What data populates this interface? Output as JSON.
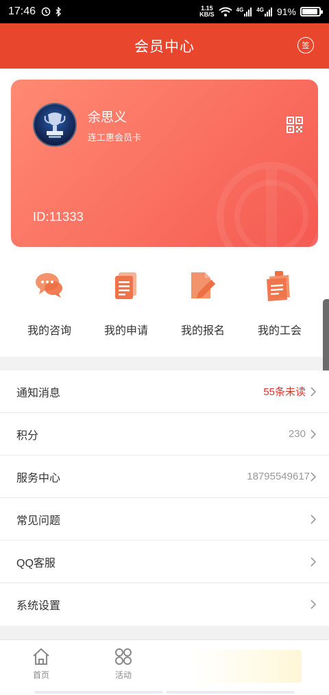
{
  "status_bar": {
    "time": "17:46",
    "network_speed_value": "1.15",
    "network_speed_unit": "KB/S",
    "signal_1_label": "4G",
    "signal_2_label": "4G",
    "battery_percent": "91%",
    "battery_level": 0.91
  },
  "header": {
    "title": "会员中心",
    "sign_label": "签"
  },
  "card": {
    "name": "余思义",
    "card_type": "连工惠会员卡",
    "id_text": "ID:11333",
    "colors": {
      "start": "#ff8a72",
      "end": "#f55a52"
    }
  },
  "shortcuts": [
    {
      "label": "我的咨询",
      "icon": "chat-bubbles-icon"
    },
    {
      "label": "我的申请",
      "icon": "document-list-icon"
    },
    {
      "label": "我的报名",
      "icon": "edit-document-icon"
    },
    {
      "label": "我的工会",
      "icon": "clipboard-note-icon"
    }
  ],
  "menu": [
    {
      "label": "通知消息",
      "value": "55条未读",
      "value_color": "#d9362b"
    },
    {
      "label": "积分",
      "value": "230"
    },
    {
      "label": "服务中心",
      "value": "18795549617"
    },
    {
      "label": "常见问题",
      "value": ""
    },
    {
      "label": "QQ客服",
      "value": ""
    },
    {
      "label": "系统设置",
      "value": ""
    }
  ],
  "tabbar": {
    "home_label": "首页",
    "activity_label": "活动"
  },
  "theme": {
    "accent": "#e8472e",
    "icon_orange": "#f07a4e"
  }
}
